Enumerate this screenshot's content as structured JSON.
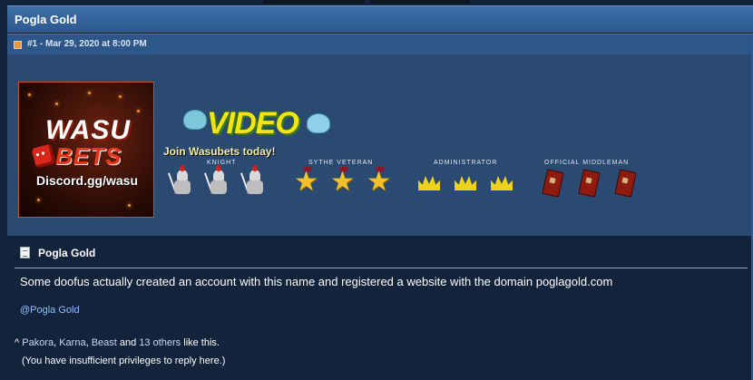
{
  "thread": {
    "title": "Pogla Gold"
  },
  "post": {
    "meta": "#1 - Mar 29, 2020 at 8:00 PM",
    "title": "Pogla Gold",
    "message": "Some doofus actually created an account with this name and registered a website with the domain poglagold.com",
    "mention": "@Pogla Gold"
  },
  "signature": {
    "banner": {
      "brand_top": "WASU",
      "brand_bottom": "BETS",
      "discord": "Discord.gg/wasu"
    },
    "video_logo": "VIDEO",
    "join_text": "Join Wasubets today!",
    "ranks": [
      {
        "label": "Knight",
        "icon": "knight-helmet-icon",
        "count": 3
      },
      {
        "label": "Sythe Veteran",
        "icon": "gold-star-medal-icon",
        "count": 3
      },
      {
        "label": "Administrator",
        "icon": "gold-crown-icon",
        "count": 3
      },
      {
        "label": "Official Middleman",
        "icon": "red-book-icon",
        "count": 3
      }
    ]
  },
  "likes": {
    "prefix": "^",
    "users": [
      "Pakora",
      "Karna",
      "Beast"
    ],
    "sep1": ", ",
    "sep2": ", ",
    "and_text": " and ",
    "others_link": "13 others",
    "suffix": " like this."
  },
  "reply_notice": "(You have insufficient privileges to reply here.)",
  "colors": {
    "header_blue": "#3d6ea6",
    "meta_blue": "#2d5689",
    "signature_bg": "#2b4a72",
    "body_bg": "#13233b",
    "link": "#8fc0ff"
  }
}
